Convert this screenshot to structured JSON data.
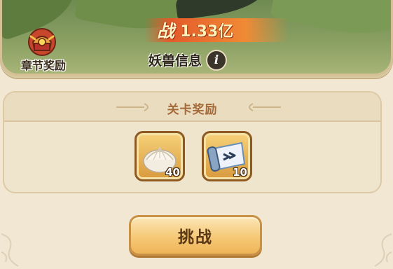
{
  "scene": {
    "power_label": "战",
    "power_value": "1.33亿",
    "beast_info_label": "妖兽信息",
    "info_icon": "info-icon"
  },
  "chapter_reward": {
    "label": "章节奖励",
    "icon": "treasure-chest-icon"
  },
  "rewards": {
    "title": "关卡奖励",
    "items": [
      {
        "icon": "steamed-bun-icon",
        "count": "40"
      },
      {
        "icon": "scroll-ticket-icon",
        "count": "10"
      }
    ]
  },
  "challenge_button": {
    "label": "挑战"
  },
  "colors": {
    "accent": "#e45a2a",
    "panel_bg": "#efe4cc",
    "button_gold": "#f6c977",
    "title_brown": "#a46a3a"
  }
}
